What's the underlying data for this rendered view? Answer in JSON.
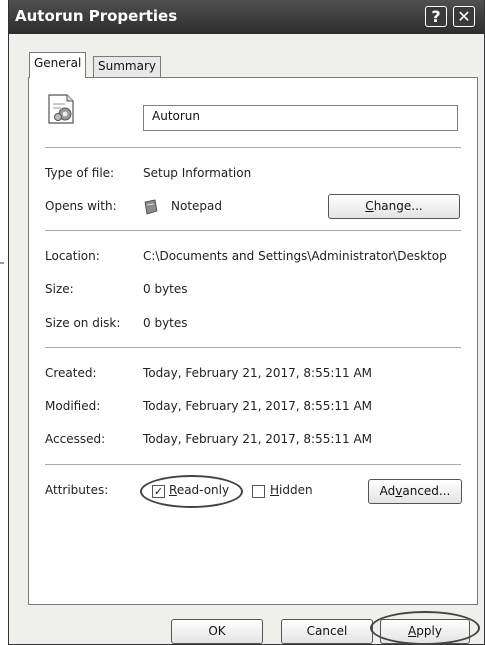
{
  "window": {
    "title": "Autorun Properties",
    "help_label": "?",
    "close_label": "✕"
  },
  "tabs": [
    {
      "label": "General",
      "selected": true
    },
    {
      "label": "Summary",
      "selected": false
    }
  ],
  "general": {
    "file_name": "Autorun",
    "icon": "setup-info-file-icon",
    "type_label": "Type of file:",
    "type_value": "Setup Information",
    "opens_label": "Opens with:",
    "opens_value": "Notepad",
    "opens_icon": "notepad-icon",
    "change_button": "Change...",
    "location_label": "Location:",
    "location_value": "C:\\Documents and Settings\\Administrator\\Desktop",
    "size_label": "Size:",
    "size_value": "0 bytes",
    "size_on_disk_label": "Size on disk:",
    "size_on_disk_value": "0 bytes",
    "created_label": "Created:",
    "created_value": "Today, February 21, 2017, 8:55:11 AM",
    "modified_label": "Modified:",
    "modified_value": "Today, February 21, 2017, 8:55:11 AM",
    "accessed_label": "Accessed:",
    "accessed_value": "Today, February 21, 2017, 8:55:11 AM",
    "attributes_label": "Attributes:",
    "readonly_label": "Read-only",
    "readonly_checked": true,
    "hidden_label": "Hidden",
    "hidden_checked": false,
    "advanced_button": "Advanced..."
  },
  "footer": {
    "ok_button": "OK",
    "cancel_button": "Cancel",
    "apply_button": "Apply"
  }
}
